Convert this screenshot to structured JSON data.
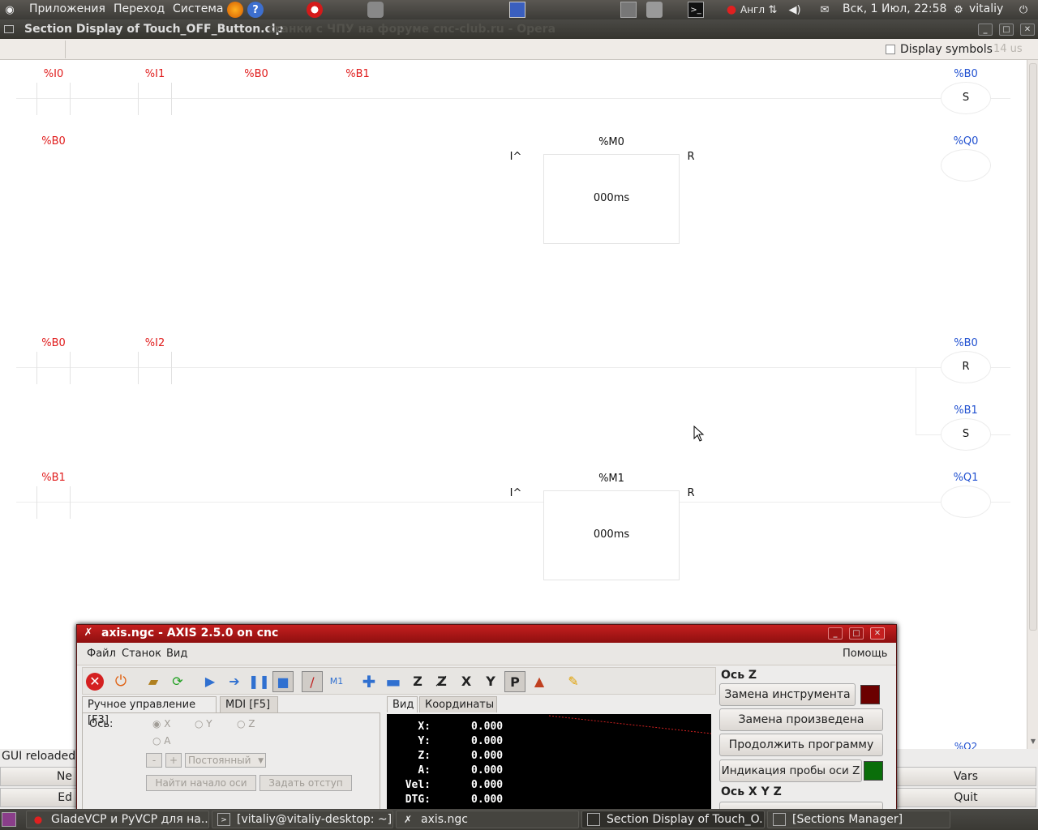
{
  "topbar": {
    "menu": [
      "Приложения",
      "Переход",
      "Система"
    ],
    "clock": "Вск,  1 Июл, 22:58",
    "user": "vitaliy",
    "keyboard": "Англ",
    "icons": [
      "ubuntu-logo-icon",
      "firefox-icon",
      "help-icon",
      "opera-icon",
      "gimp-icon",
      "network-icon",
      "calculator-icon",
      "camera-icon",
      "terminal-icon",
      "volume-icon",
      "mail-icon",
      "power-icon"
    ]
  },
  "window": {
    "title": "Section Display of Touch_OFF_Button.clp",
    "ghost_title": "станки с ЧПУ на форуме cnc-club.ru - Opera",
    "buttons": [
      "_",
      "□",
      "✕"
    ]
  },
  "toolbar": {
    "display_symbols": "Display symbols",
    "time": "14 us"
  },
  "ladder": {
    "rung1": {
      "contacts": [
        "%I0",
        "%I1",
        "%B0",
        "%B1"
      ],
      "coil_var": "%B0",
      "coil": "S"
    },
    "rung2": {
      "contact": "%B0",
      "timer_var": "%M0",
      "timer_in": "I^",
      "timer_reset": "R",
      "timer_value": "000ms",
      "coil_var": "%Q0"
    },
    "rung3": {
      "contacts": [
        "%B0",
        "%I2"
      ],
      "coil1_var": "%B0",
      "coil1": "R",
      "coil2_var": "%B1",
      "coil2": "S"
    },
    "rung4": {
      "contact": "%B1",
      "timer_var": "%M1",
      "timer_in": "I^",
      "timer_reset": "R",
      "timer_value": "000ms",
      "coil_var": "%Q1"
    },
    "partial_label": "%Q2"
  },
  "axis": {
    "title": "axis.ngc - AXIS 2.5.0 on cnc",
    "menu": [
      "Файл",
      "Станок",
      "Вид"
    ],
    "help": "Помощь",
    "tabs": [
      "Ручное управление [F3]",
      "MDI [F5]"
    ],
    "axis_label": "Ось:",
    "axes": [
      "X",
      "Y",
      "Z",
      "A"
    ],
    "minus": "-",
    "plus": "+",
    "jog_mode": "Постоянный",
    "home_btn": "Найти начало оси",
    "offset_btn": "Задать отступ",
    "view_tabs": [
      "Вид",
      "Координаты"
    ],
    "dro": [
      {
        "k": "X:",
        "v": "0.000"
      },
      {
        "k": "Y:",
        "v": "0.000"
      },
      {
        "k": "Z:",
        "v": "0.000"
      },
      {
        "k": "A:",
        "v": "0.000"
      },
      {
        "k": "Vel:",
        "v": "0.000"
      },
      {
        "k": "DTG:",
        "v": "0.000"
      }
    ],
    "right": {
      "section1": "Ось Z",
      "b1": "Замена инструмента",
      "b2": "Замена произведена",
      "b3": "Продолжить программу",
      "b4": "Индикация пробы оси Z",
      "section2": "Ось X Y Z",
      "status_red": "#6b0000",
      "status_green": "#0a6e0a"
    }
  },
  "bottom": {
    "status": "GUI reloaded",
    "left_btn1": "Ne",
    "left_btn2": "Ed",
    "vars": "Vars",
    "quit": "Quit"
  },
  "taskbar": {
    "items": [
      "GladeVCP и PyVCP для на...",
      "[vitaliy@vitaliy-desktop: ~]",
      "axis.ngc",
      "Section Display of Touch_O...",
      "[Sections Manager]"
    ]
  }
}
